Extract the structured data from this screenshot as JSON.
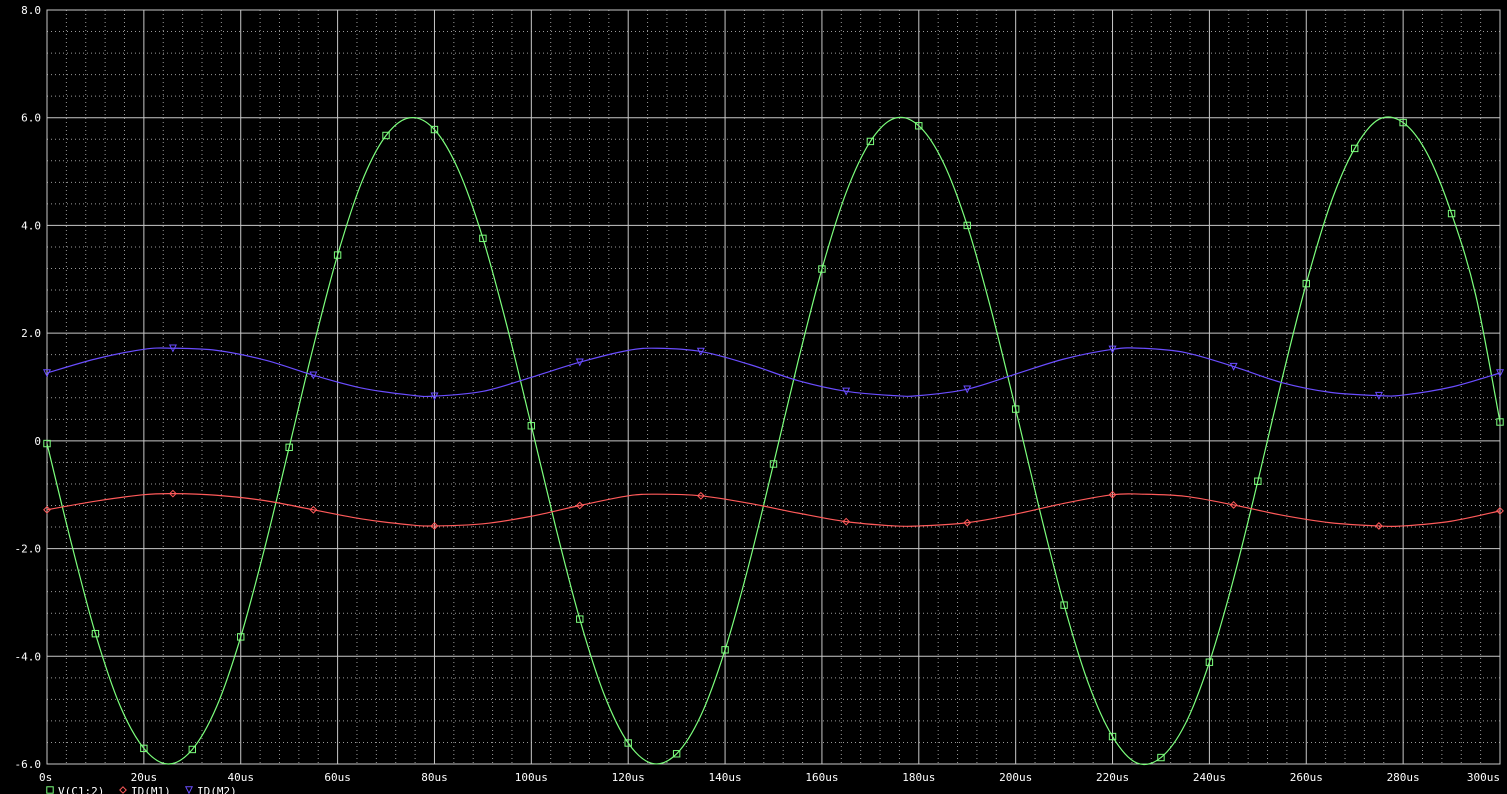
{
  "colors": {
    "background": "#000000",
    "grid_major": "#c8c8c8",
    "grid_minor": "#9a9a9a",
    "axis_text": "#ffffff"
  },
  "chart_data": {
    "type": "line",
    "title": "",
    "xlabel": "",
    "ylabel": "",
    "xlim": [
      0,
      300
    ],
    "ylim": [
      -6.0,
      8.0
    ],
    "x_unit": "us",
    "grid": true,
    "grid_style": "major solid, minor dotted",
    "legend_placement": "bottom-left",
    "x_ticks": [
      0,
      20,
      40,
      60,
      80,
      100,
      120,
      140,
      160,
      180,
      200,
      220,
      240,
      260,
      280,
      300
    ],
    "x_tick_labels": [
      "0s",
      "20us",
      "40us",
      "60us",
      "80us",
      "100us",
      "120us",
      "140us",
      "160us",
      "180us",
      "200us",
      "220us",
      "240us",
      "260us",
      "280us",
      "300us"
    ],
    "y_ticks": [
      8.0,
      6.0,
      4.0,
      2.0,
      0,
      -2.0,
      -4.0,
      -6.0
    ],
    "y_tick_labels": [
      "8.0",
      "6.0",
      "4.0",
      "2.0",
      "0",
      "-2.0",
      "-4.0",
      "-6.0"
    ],
    "series": [
      {
        "name": "V(C1:2)",
        "color": "#7cff7c",
        "marker": "square",
        "x": [
          0,
          5,
          10,
          15,
          20,
          25,
          30,
          35,
          40,
          45,
          50,
          55,
          60,
          65,
          70,
          75,
          80,
          85,
          90,
          95,
          100,
          105,
          110,
          115,
          120,
          125,
          130,
          135,
          140,
          145,
          150,
          155,
          160,
          165,
          170,
          175,
          180,
          185,
          190,
          195,
          200,
          205,
          210,
          215,
          220,
          225,
          230,
          235,
          240,
          245,
          250,
          255,
          260,
          265,
          270,
          275,
          280,
          285,
          290,
          295,
          300
        ],
        "y": [
          -0.05,
          -1.89,
          -3.58,
          -4.9,
          -5.71,
          -6.0,
          -5.73,
          -4.94,
          -3.64,
          -1.97,
          -0.12,
          1.75,
          3.45,
          4.81,
          5.67,
          6.0,
          5.78,
          5.02,
          3.76,
          2.12,
          0.28,
          -1.59,
          -3.31,
          -4.7,
          -5.61,
          -5.99,
          -5.81,
          -5.1,
          -3.88,
          -2.27,
          -0.43,
          1.45,
          3.19,
          4.61,
          5.56,
          5.99,
          5.85,
          5.18,
          4.0,
          2.41,
          0.59,
          -1.3,
          -3.05,
          -4.5,
          -5.49,
          -5.98,
          -5.88,
          -5.26,
          -4.11,
          -2.56,
          -0.75,
          1.15,
          2.92,
          4.4,
          5.43,
          5.97,
          5.91,
          5.33,
          4.22,
          2.7,
          0.35
        ]
      },
      {
        "name": "ID(M1)",
        "color": "#ff5a5a",
        "marker": "diamond",
        "x": [
          0,
          10,
          20,
          26,
          35,
          45,
          55,
          65,
          75,
          80,
          90,
          100,
          110,
          120,
          126,
          135,
          145,
          155,
          165,
          175,
          180,
          190,
          200,
          210,
          220,
          226,
          235,
          245,
          255,
          265,
          275,
          280,
          290,
          300
        ],
        "y": [
          -1.28,
          -1.12,
          -1.0,
          -0.98,
          -1.01,
          -1.11,
          -1.28,
          -1.45,
          -1.56,
          -1.58,
          -1.54,
          -1.4,
          -1.2,
          -1.02,
          -0.99,
          -1.02,
          -1.16,
          -1.34,
          -1.5,
          -1.58,
          -1.58,
          -1.52,
          -1.36,
          -1.16,
          -1.0,
          -0.99,
          -1.03,
          -1.19,
          -1.38,
          -1.52,
          -1.58,
          -1.58,
          -1.49,
          -1.3
        ]
      },
      {
        "name": "ID(M2)",
        "color": "#6a4dff",
        "marker": "triangle-down",
        "x": [
          0,
          10,
          20,
          26,
          35,
          45,
          55,
          65,
          75,
          80,
          90,
          100,
          110,
          120,
          126,
          135,
          145,
          155,
          165,
          175,
          180,
          190,
          200,
          210,
          220,
          226,
          235,
          245,
          255,
          265,
          275,
          280,
          290,
          300
        ],
        "y": [
          1.26,
          1.52,
          1.7,
          1.72,
          1.68,
          1.5,
          1.22,
          0.98,
          0.85,
          0.83,
          0.92,
          1.18,
          1.46,
          1.68,
          1.72,
          1.66,
          1.42,
          1.12,
          0.92,
          0.84,
          0.84,
          0.96,
          1.24,
          1.52,
          1.7,
          1.72,
          1.64,
          1.38,
          1.08,
          0.9,
          0.84,
          0.85,
          1.0,
          1.26
        ]
      }
    ]
  }
}
